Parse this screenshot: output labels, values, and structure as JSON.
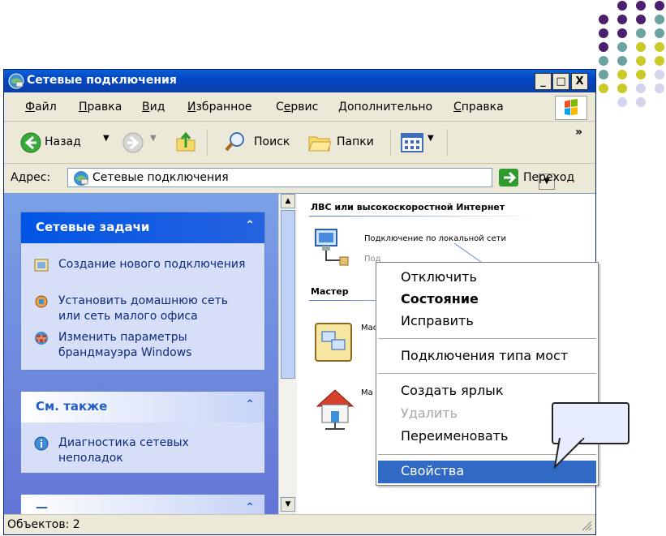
{
  "window": {
    "title": "Сетевые подключения",
    "buttons": {
      "minimize": "_",
      "maximize": "□",
      "close": "X"
    }
  },
  "menu": [
    {
      "label": "Файл",
      "u": "Ф",
      "rest": "айл"
    },
    {
      "label": "Правка",
      "u": "П",
      "rest": "равка"
    },
    {
      "label": "Вид",
      "u": "В",
      "rest": "ид"
    },
    {
      "label": "Избранное",
      "u": "И",
      "rest": "збранное"
    },
    {
      "label": "Сервис",
      "pre": "С",
      "u": "е",
      "rest": "рвис"
    },
    {
      "label": "Дополнительно",
      "u": "Д",
      "rest": "ополнительно"
    },
    {
      "label": "Справка",
      "u": "С",
      "rest": "правка"
    }
  ],
  "toolbar": {
    "back": "Назад",
    "search": "Поиск",
    "folders": "Папки",
    "chevron": "»"
  },
  "address": {
    "label": "Адрес:",
    "value": "Сетевые подключения",
    "go": "Переход"
  },
  "leftpane": {
    "tasks_title": "Сетевые задачи",
    "tasks": [
      "Создание нового подключения",
      "Установить домашнюю сеть или сеть малого офиса",
      "Изменить параметры брандмауэра Windows"
    ],
    "see_also_title": "См. также",
    "see_also": [
      "Диагностика сетевых неполадок"
    ],
    "collapse_glyph": "«"
  },
  "rightpane": {
    "group_lan": "ЛВС или высокоскоростной Интернет",
    "lan_item": "Подключение по локальной сети",
    "lan_sub": "Под",
    "group_wizard": "Мастер",
    "wizard1": "Мас",
    "wizard2": "Ма"
  },
  "context_menu": {
    "items": [
      {
        "label": "Отключить",
        "style": "normal"
      },
      {
        "label": "Состояние",
        "style": "bold"
      },
      {
        "label": "Исправить",
        "style": "normal"
      },
      {
        "label": "Подключения типа мост",
        "style": "normal"
      },
      {
        "label": "Создать ярлык",
        "style": "normal"
      },
      {
        "label": "Удалить",
        "style": "disabled"
      },
      {
        "label": "Переименовать",
        "style": "normal"
      },
      {
        "label": "Свойства",
        "style": "highlighted"
      }
    ]
  },
  "status": {
    "text": "Объектов: 2"
  },
  "colors": {
    "titlebar": "#0347c4",
    "highlight": "#316ac5",
    "dot_purple": "#4b1f6e",
    "dot_teal": "#6aa3a0",
    "dot_yellow": "#c9c928",
    "dot_lavender": "#d3d3ec"
  }
}
